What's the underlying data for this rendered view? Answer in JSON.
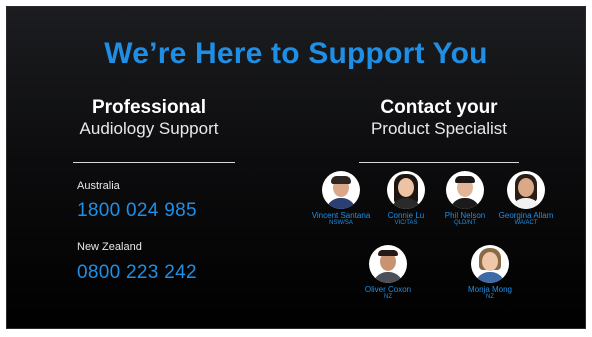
{
  "title": "We’re Here to Support You",
  "audiology": {
    "heading_bold": "Professional",
    "heading_sub": "Audiology Support",
    "contacts": [
      {
        "region": "Australia",
        "phone": "1800 024 985"
      },
      {
        "region": "New Zealand",
        "phone": "0800 223 242"
      }
    ]
  },
  "specialists": {
    "heading_bold": "Contact your",
    "heading_sub": "Product Specialist",
    "people": [
      {
        "name": "Vincent Santana",
        "region": "NSW/SA",
        "icon": "person-photo-icon"
      },
      {
        "name": "Connie Lu",
        "region": "VIC/TAS",
        "icon": "person-photo-icon"
      },
      {
        "name": "Phil Nelson",
        "region": "QLD/NT",
        "icon": "person-photo-icon"
      },
      {
        "name": "Georgina Allam",
        "region": "WA/ACT",
        "icon": "person-photo-icon"
      },
      {
        "name": "Oliver Coxon",
        "region": "NZ",
        "icon": "person-photo-icon"
      },
      {
        "name": "Monja Mong",
        "region": "NZ",
        "icon": "person-photo-icon"
      }
    ]
  },
  "colors": {
    "accent": "#1f8fe6",
    "background_top": "#1c1d20",
    "background_bottom": "#000000",
    "text": "#ffffff"
  }
}
